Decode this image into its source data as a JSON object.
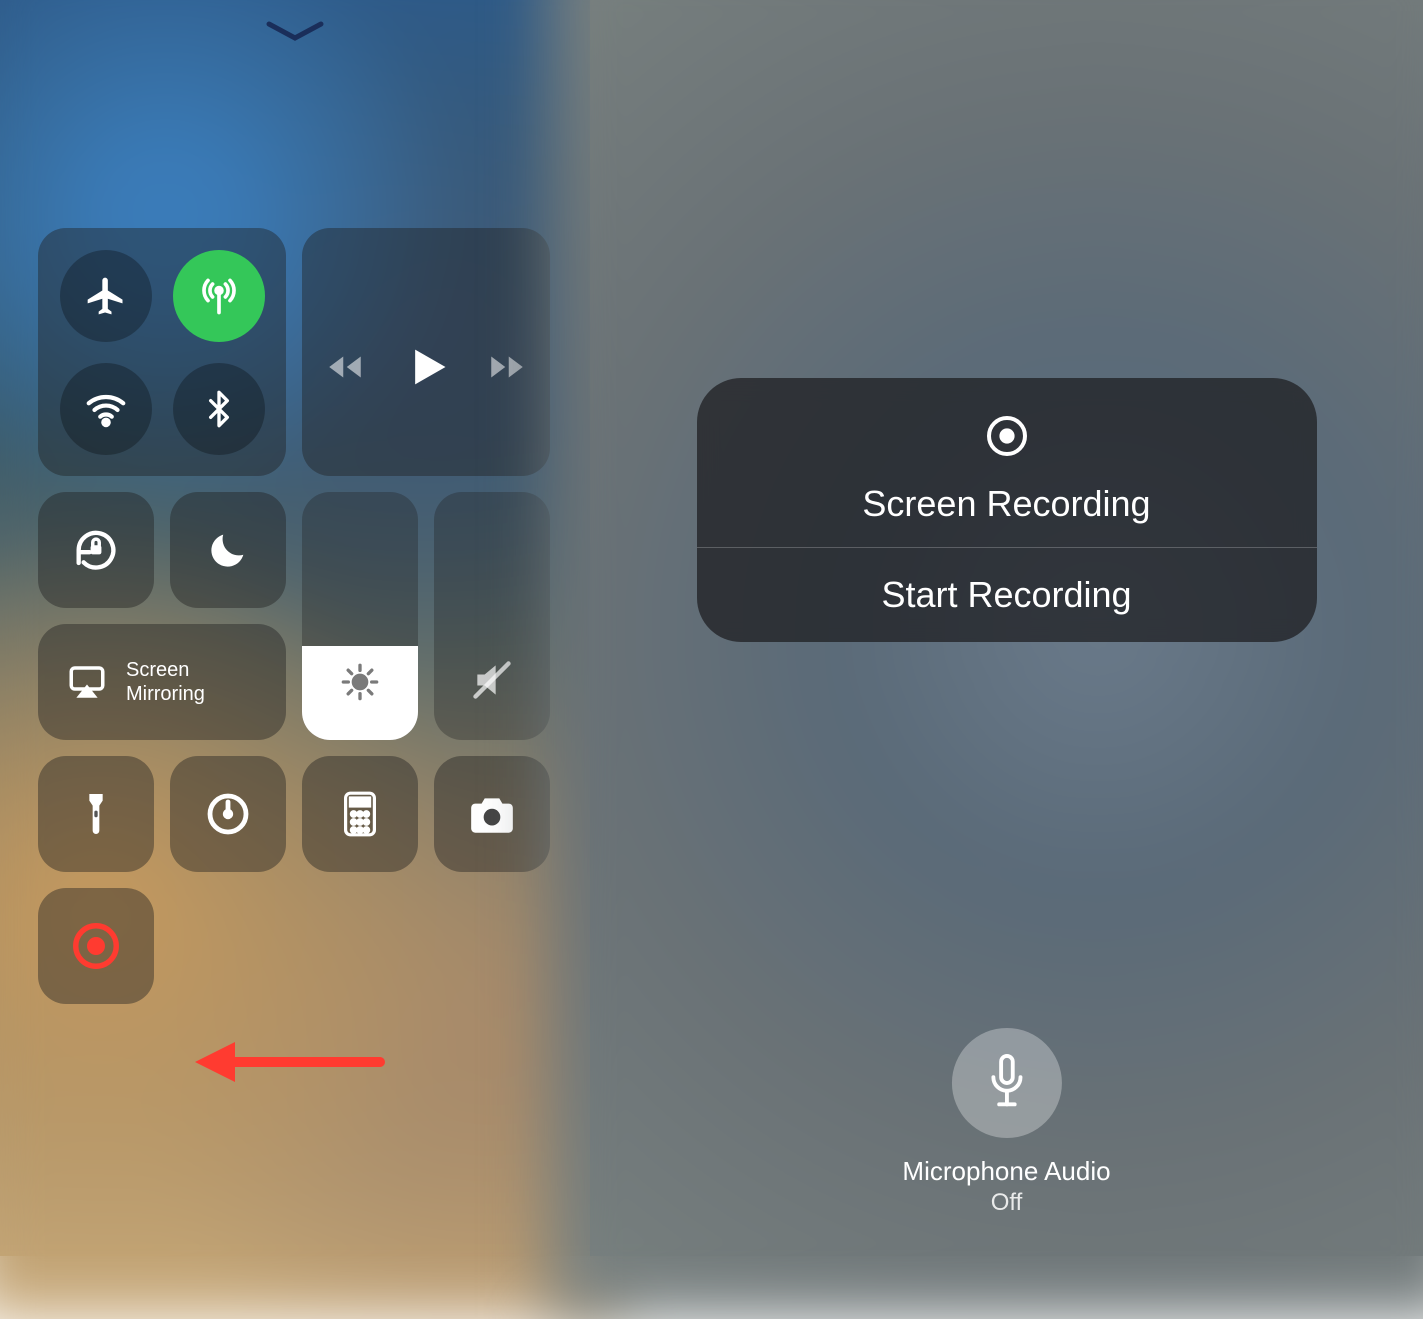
{
  "left": {
    "screen_mirroring": {
      "line1": "Screen",
      "line2": "Mirroring"
    },
    "connectivity": {
      "airplane": "airplane",
      "cellular": "cellular",
      "wifi": "wifi",
      "bluetooth": "bluetooth",
      "cellular_active": true
    },
    "brightness_pct": 38,
    "volume_muted": true
  },
  "right": {
    "popup": {
      "title": "Screen Recording",
      "action": "Start Recording"
    },
    "mic": {
      "label": "Microphone Audio",
      "status": "Off"
    }
  }
}
